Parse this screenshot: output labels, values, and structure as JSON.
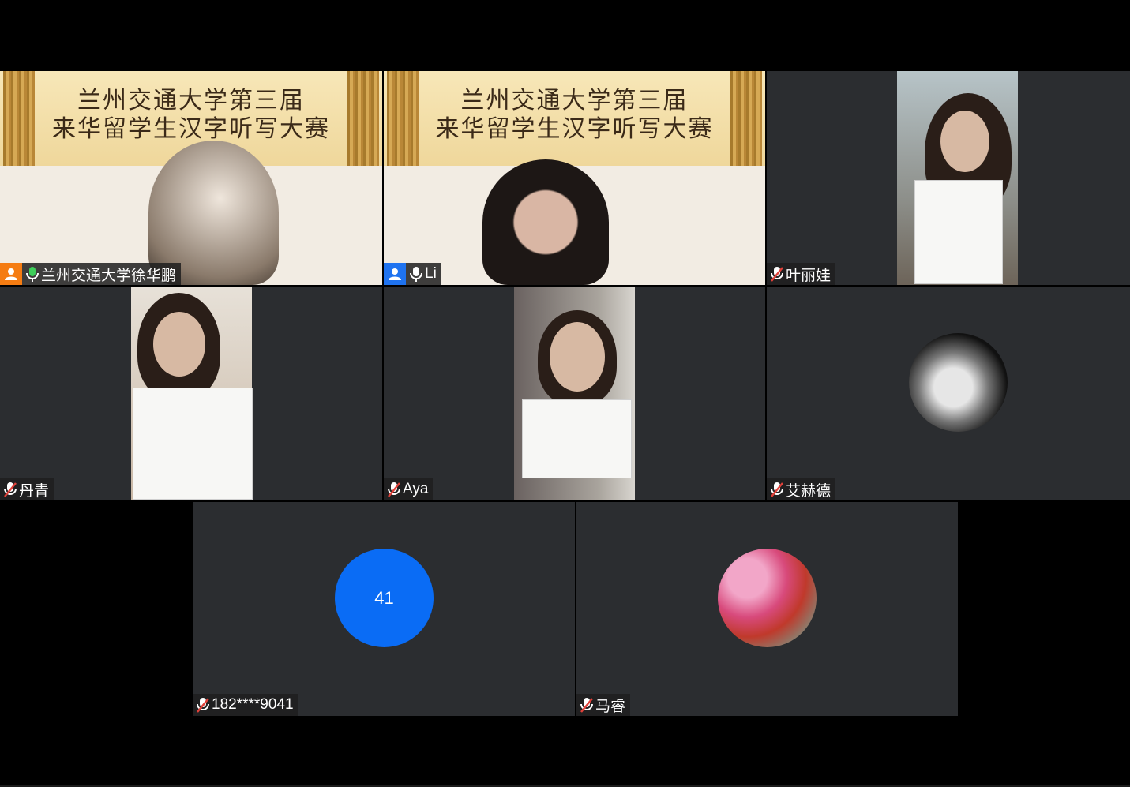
{
  "banner": {
    "line1": "兰州交通大学第三届",
    "line2": "来华留学生汉字听写大赛"
  },
  "participants": [
    {
      "name": "兰州交通大学徐华鹏",
      "role": "host",
      "mic": "on"
    },
    {
      "name": "Li",
      "role": "cohost",
      "mic": "on"
    },
    {
      "name": "叶丽娃",
      "mic": "off"
    },
    {
      "name": "丹青",
      "mic": "off"
    },
    {
      "name": "Aya",
      "mic": "off"
    },
    {
      "name": "艾赫德",
      "mic": "off"
    },
    {
      "name": "182****9041",
      "mic": "off",
      "avatar_text": "41"
    },
    {
      "name": "马睿",
      "mic": "off"
    }
  ],
  "colors": {
    "host_badge": "#f57c12",
    "cohost_badge": "#1f73f0",
    "mic_on": "#3ecf5a",
    "mic_off": "#e0413a",
    "number_avatar": "#0a6cf5",
    "active_speaker_border": "#3ecf8e"
  },
  "icons": {
    "host": "person-icon",
    "mic_on": "mic-icon",
    "mic_off": "mic-muted-icon"
  }
}
